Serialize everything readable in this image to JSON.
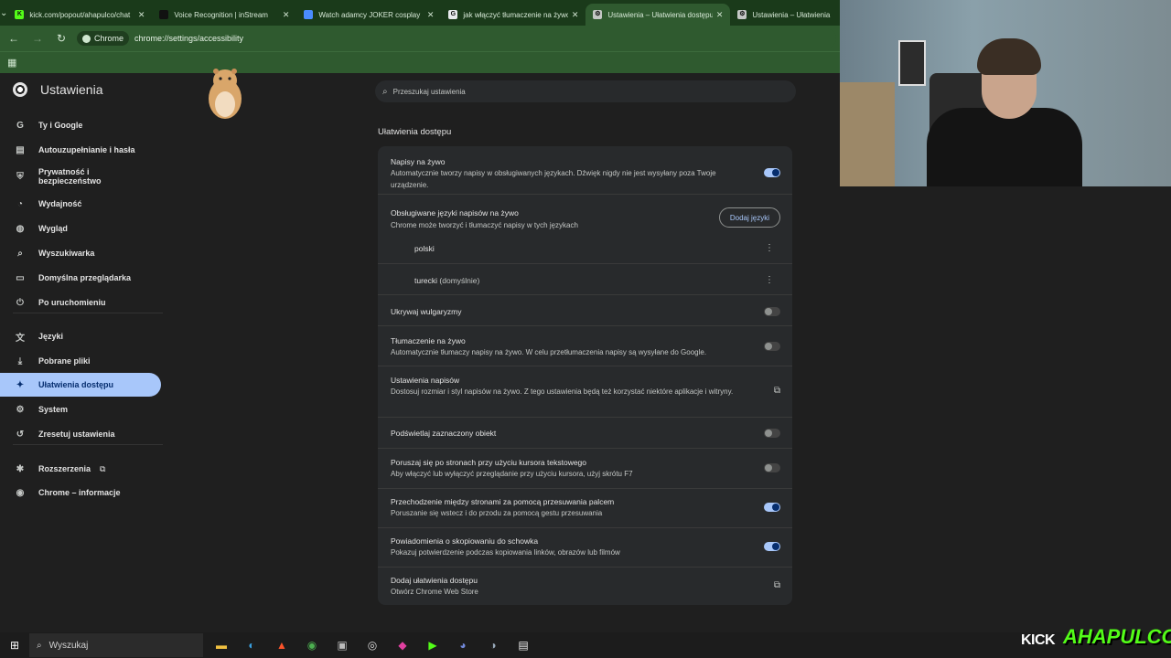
{
  "tabs": [
    {
      "title": "kick.com/popout/ahapulco/chat",
      "fav_color": "#53fc18",
      "fav_glyph": "K",
      "active": false
    },
    {
      "title": "Voice Recognition | inStream",
      "fav_color": "#111111",
      "fav_glyph": "",
      "active": false
    },
    {
      "title": "Watch adamcy JOKER cosplay",
      "fav_color": "#4a8cff",
      "fav_glyph": "",
      "active": false
    },
    {
      "title": "jak włączyć tłumaczenie na żywo",
      "fav_color": "#e8eaed",
      "fav_glyph": "G",
      "active": false
    },
    {
      "title": "Ustawienia – Ułatwienia dostępu",
      "fav_color": "#c4c7c5",
      "fav_glyph": "⚙",
      "active": true
    },
    {
      "title": "Ustawienia – Ułatwienia",
      "fav_color": "#c4c7c5",
      "fav_glyph": "⚙",
      "active": false
    }
  ],
  "omnibox": {
    "chip": "Chrome",
    "url": "chrome://settings/accessibility"
  },
  "sidebar": {
    "title": "Ustawienia",
    "items": [
      {
        "label": "Ty i Google",
        "icon": "G"
      },
      {
        "label": "Autouzupełnianie i hasła",
        "icon": "▤"
      },
      {
        "label": "Prywatność i bezpieczeństwo",
        "icon": "⛨"
      },
      {
        "label": "Wydajność",
        "icon": "◔"
      },
      {
        "label": "Wygląd",
        "icon": "◍"
      },
      {
        "label": "Wyszukiwarka",
        "icon": "⌕"
      },
      {
        "label": "Domyślna przeglądarka",
        "icon": "▭"
      },
      {
        "label": "Po uruchomieniu",
        "icon": "⏻"
      },
      {
        "label": "Języki",
        "icon": "文"
      },
      {
        "label": "Pobrane pliki",
        "icon": "⤓"
      },
      {
        "label": "Ułatwienia dostępu",
        "icon": "✦"
      },
      {
        "label": "System",
        "icon": "⚙"
      },
      {
        "label": "Zresetuj ustawienia",
        "icon": "↺"
      },
      {
        "label": "Rozszerzenia",
        "icon": "✱"
      },
      {
        "label": "Chrome – informacje",
        "icon": "◉"
      }
    ]
  },
  "search": {
    "placeholder": "Przeszukaj ustawienia"
  },
  "section": {
    "title": "Ułatwienia dostępu"
  },
  "settings": {
    "live_captions": {
      "label": "Napisy na żywo",
      "sub": "Automatycznie tworzy napisy w obsługiwanych językach. Dźwięk nigdy nie jest wysyłany poza Twoje urządzenie.",
      "on": true
    },
    "languages": {
      "label": "Obsługiwane języki napisów na żywo",
      "sub": "Chrome może tworzyć i tłumaczyć napisy w tych językach",
      "button": "Dodaj języki",
      "list": [
        {
          "name": "polski",
          "note": ""
        },
        {
          "name": "turecki",
          "note": "(domyślnie)"
        }
      ]
    },
    "profanity": {
      "label": "Ukrywaj wulgaryzmy",
      "on": false
    },
    "live_translate": {
      "label": "Tłumaczenie na żywo",
      "sub": "Automatycznie tłumaczy napisy na żywo. W celu przetłumaczenia napisy są wysyłane do Google.",
      "on": false
    },
    "caption_settings": {
      "label": "Ustawienia napisów",
      "sub": "Dostosuj rozmiar i styl napisów na żywo. Z tego ustawienia będą też korzystać niektóre aplikacje i witryny."
    },
    "highlight": {
      "label": "Podświetlaj zaznaczony obiekt",
      "on": false
    },
    "caret": {
      "label": "Poruszaj się po stronach przy użyciu kursora tekstowego",
      "sub": "Aby włączyć lub wyłączyć przeglądanie przy użyciu kursora, użyj skrótu F7",
      "on": false
    },
    "swipe": {
      "label": "Przechodzenie między stronami za pomocą przesuwania palcem",
      "sub": "Poruszanie się wstecz i do przodu za pomocą gestu przesuwania",
      "on": true
    },
    "clipboard": {
      "label": "Powiadomienia o skopiowaniu do schowka",
      "sub": "Pokazuj potwierdzenie podczas kopiowania linków, obrazów lub filmów",
      "on": true
    },
    "add_accessibility": {
      "label": "Dodaj ułatwienia dostępu",
      "sub": "Otwórz Chrome Web Store"
    }
  },
  "taskbar": {
    "search": "Wyszukaj"
  },
  "stream": {
    "brand": "KICK",
    "channel": "AHAPULCO"
  },
  "colors": {
    "accent": "#a8c7fa",
    "tab_bar": "#1a3a1a",
    "toolbar": "#2f5a2f",
    "bg": "#1f1f1f",
    "card": "#282a2c"
  }
}
